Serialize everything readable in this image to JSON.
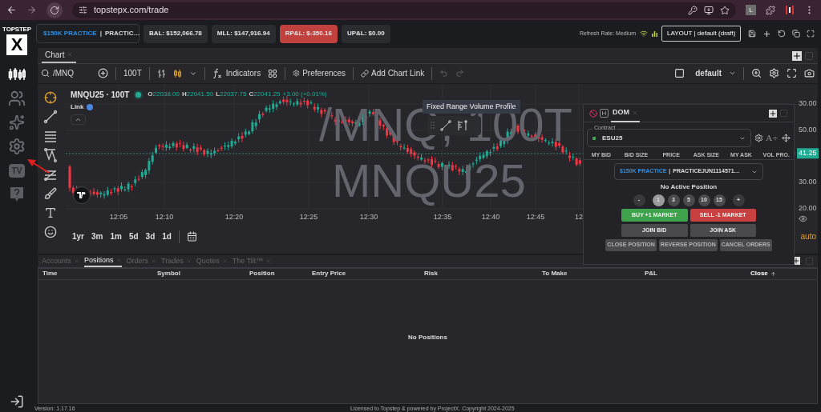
{
  "browser": {
    "url": "topstepx.com/trade",
    "profile_initial": "L"
  },
  "logo": {
    "text": "TOPSTEP",
    "mark": "X"
  },
  "sidebar": {
    "items": [
      {
        "kind": "chart",
        "selected": true
      },
      {
        "kind": "community",
        "selected": false
      },
      {
        "kind": "analytics",
        "selected": false
      },
      {
        "kind": "settings",
        "selected": false
      },
      {
        "kind": "badge",
        "label": "TV",
        "selected": false
      },
      {
        "kind": "help",
        "selected": false
      }
    ]
  },
  "account_select": {
    "tag": "$150K PRACTICE",
    "separator": "|",
    "name": "PRACTIC…"
  },
  "stats": [
    {
      "label": "BAL: $152,066.78",
      "loss": false
    },
    {
      "label": "MLL: $147,916.94",
      "loss": false
    },
    {
      "label": "RP&L: $-350.16",
      "loss": true
    },
    {
      "label": "UP&L: $0.00",
      "loss": false
    }
  ],
  "refresh_rate": "Refresh Rate: Medium",
  "layout_select": "LAYOUT | default (draft)",
  "chart_panel": {
    "tab": "Chart",
    "toolbar": {
      "symbol": "/MNQ",
      "interval": "100T",
      "indicators": "Indicators",
      "preferences": "Preferences",
      "add_chart_link": "Add Chart Link",
      "template": "default"
    },
    "legend": {
      "title": "MNQU25 · 100T",
      "ohlc": [
        {
          "label": "O",
          "value": "22038.00"
        },
        {
          "label": "H",
          "value": "22041.50"
        },
        {
          "label": "L",
          "value": "22037.75"
        },
        {
          "label": "C",
          "value": "22041.25"
        }
      ],
      "change": "+3.00 (+0.01%)",
      "link": "Link"
    },
    "watermark": [
      "/MNQ, 100T",
      "MNQU25"
    ],
    "tooltip": "Fixed Range Volume Profile",
    "time_axis": [
      "12:05",
      "12:10",
      "12:20",
      "12:25",
      "12:30",
      "12:35",
      "12:40",
      "12:45",
      "12"
    ],
    "price_axis": [
      {
        "label": "30.00",
        "current": false
      },
      {
        "label": "50.00",
        "current": false
      },
      {
        "label": "41.25",
        "current": true
      },
      {
        "label": "30.00",
        "current": false
      },
      {
        "label": "20.00",
        "current": false
      }
    ],
    "scale_mode": "auto",
    "ranges": [
      "1yr",
      "3m",
      "1m",
      "5d",
      "3d",
      "1d"
    ]
  },
  "dom": {
    "hotkey_label": "H",
    "tab": "DOM",
    "font_control": "A÷",
    "contract_label": "Contract",
    "contract": "ESU25",
    "columns": [
      "MY BID",
      "BID SIZE",
      "PRICE",
      "ASK SIZE",
      "MY ASK",
      "VOL PRO."
    ],
    "account_tag": "$150K PRACTICE",
    "account_separator": "|",
    "account_name": "PRACTICEJUN1114571…",
    "status": "No Active Position",
    "quantities": [
      {
        "label": "-",
        "kind": "step",
        "selected": false
      },
      {
        "label": "1",
        "kind": "size",
        "selected": true
      },
      {
        "label": "3",
        "kind": "size",
        "selected": false
      },
      {
        "label": "5",
        "kind": "size",
        "selected": false
      },
      {
        "label": "10",
        "kind": "size",
        "selected": false
      },
      {
        "label": "15",
        "kind": "size",
        "selected": false
      },
      {
        "label": "+",
        "kind": "step",
        "selected": false
      }
    ],
    "actions": [
      {
        "label": "BUY +1 MARKET",
        "kind": "buy",
        "disabled": false
      },
      {
        "label": "SELL -1 MARKET",
        "kind": "sell",
        "disabled": false
      },
      {
        "label": "JOIN BID",
        "kind": "neutral",
        "disabled": false
      },
      {
        "label": "JOIN ASK",
        "kind": "neutral",
        "disabled": false
      },
      {
        "label": "CLOSE POSITION",
        "kind": "neutral",
        "disabled": true
      },
      {
        "label": "REVERSE POSITION",
        "kind": "neutral",
        "disabled": true
      },
      {
        "label": "CANCEL ORDERS",
        "kind": "neutral",
        "disabled": true
      }
    ]
  },
  "bottom_panel": {
    "tabs": [
      {
        "label": "Accounts",
        "selected": false
      },
      {
        "label": "Positions",
        "selected": true
      },
      {
        "label": "Orders",
        "selected": false
      },
      {
        "label": "Trades",
        "selected": false
      },
      {
        "label": "Quotes",
        "selected": false
      },
      {
        "label": "The Tilt™",
        "selected": false
      }
    ],
    "columns": [
      {
        "label": "Time",
        "sorted": false
      },
      {
        "label": "Symbol",
        "sorted": false
      },
      {
        "label": "Position",
        "sorted": false
      },
      {
        "label": "Entry Price",
        "sorted": false
      },
      {
        "label": "Risk",
        "sorted": false
      },
      {
        "label": "To Make",
        "sorted": false
      },
      {
        "label": "P&L",
        "sorted": false
      },
      {
        "label": "Close",
        "sorted": true
      }
    ],
    "empty": "No Positions"
  },
  "footer": {
    "version": "Version: 1.17.16",
    "license": "Licensed to Topstep & powered by ProjectX. Copyright 2024-2025"
  }
}
